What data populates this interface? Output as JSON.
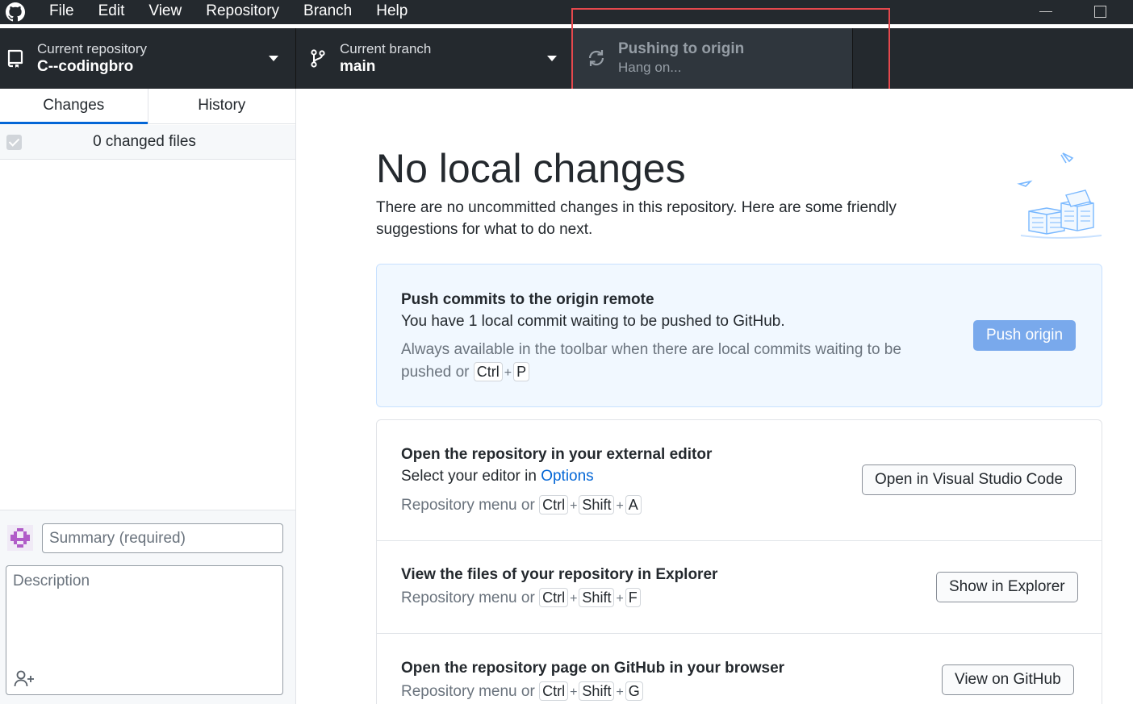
{
  "menu": {
    "items": [
      "File",
      "Edit",
      "View",
      "Repository",
      "Branch",
      "Help"
    ]
  },
  "toolbar": {
    "repository": {
      "label": "Current repository",
      "value": "C--codingbro"
    },
    "branch": {
      "label": "Current branch",
      "value": "main"
    },
    "push": {
      "label": "Pushing to origin",
      "status": "Hang on..."
    }
  },
  "sidebar": {
    "tabs": [
      {
        "label": "Changes",
        "active": true
      },
      {
        "label": "History",
        "active": false
      }
    ],
    "changed_files": "0 changed files",
    "commit": {
      "summary_placeholder": "Summary (required)",
      "description_placeholder": "Description"
    }
  },
  "main": {
    "title": "No local changes",
    "description": "There are no uncommitted changes in this repository. Here are some friendly suggestions for what to do next.",
    "push_card": {
      "title": "Push commits to the origin remote",
      "text": "You have 1 local commit waiting to be pushed to GitHub.",
      "hint_line1": "Always available in the toolbar when there are local commits waiting to be",
      "hint_line2": "pushed or",
      "shortcut": [
        "Ctrl",
        "P"
      ],
      "button": "Push origin"
    },
    "editor_card": {
      "title": "Open the repository in your external editor",
      "text_prefix": "Select your editor in",
      "link": "Options",
      "hint": "Repository menu or",
      "shortcut": [
        "Ctrl",
        "Shift",
        "A"
      ],
      "button": "Open in Visual Studio Code"
    },
    "explorer_card": {
      "title": "View the files of your repository in Explorer",
      "hint": "Repository menu or",
      "shortcut": [
        "Ctrl",
        "Shift",
        "F"
      ],
      "button": "Show in Explorer"
    },
    "github_card": {
      "title": "Open the repository page on GitHub in your browser",
      "hint": "Repository menu or",
      "shortcut": [
        "Ctrl",
        "Shift",
        "G"
      ],
      "button": "View on GitHub"
    }
  },
  "plus_sign": "+",
  "colors": {
    "toolbar_bg": "#24292e",
    "accent": "#0366d6",
    "primary_button": "#79a9ec",
    "highlight": "#e5484d"
  }
}
